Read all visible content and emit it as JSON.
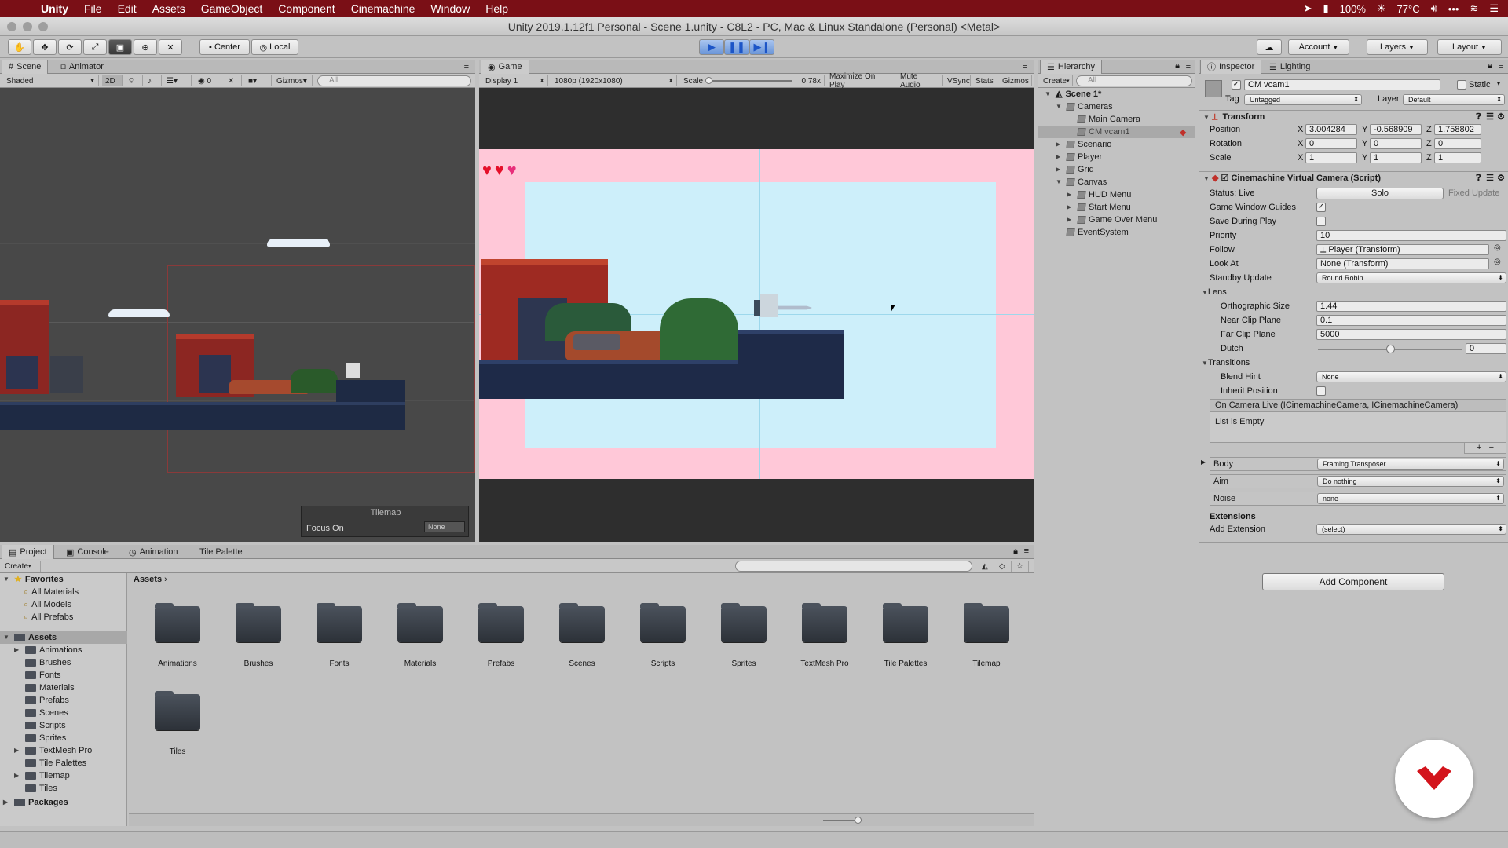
{
  "menubar": {
    "app": "Unity",
    "items": [
      "File",
      "Edit",
      "Assets",
      "GameObject",
      "Component",
      "Cinemachine",
      "Window",
      "Help"
    ],
    "battery": "100%",
    "temp": "77°C"
  },
  "window": {
    "title": "Unity 2019.1.12f1 Personal - Scene 1.unity - C8L2 - PC, Mac & Linux Standalone (Personal) <Metal>"
  },
  "toolbar": {
    "center": "Center",
    "local": "Local",
    "account": "Account",
    "layers": "Layers",
    "layout": "Layout"
  },
  "scene": {
    "tabs": [
      "Scene",
      "Animator"
    ],
    "shading": "Shaded",
    "mode2d": "2D",
    "gizmos": "Gizmos",
    "search": "All",
    "effects": "0",
    "tilemap_title": "Tilemap",
    "focus_label": "Focus On",
    "focus_value": "None"
  },
  "game": {
    "tab": "Game",
    "display": "Display 1",
    "resolution": "1080p (1920x1080)",
    "scale_label": "Scale",
    "scale_value": "0.78x",
    "buttons": [
      "Maximize On Play",
      "Mute Audio",
      "VSync",
      "Stats",
      "Gizmos"
    ]
  },
  "hierarchy": {
    "tab": "Hierarchy",
    "create": "Create",
    "search": "All",
    "scene": "Scene 1*",
    "items": [
      {
        "label": "Cameras",
        "depth": 1,
        "arrow": "▼"
      },
      {
        "label": "Main Camera",
        "depth": 2,
        "arrow": ""
      },
      {
        "label": "CM vcam1",
        "depth": 2,
        "arrow": "",
        "selected": true
      },
      {
        "label": "Scenario",
        "depth": 1,
        "arrow": "▶"
      },
      {
        "label": "Player",
        "depth": 1,
        "arrow": "▶"
      },
      {
        "label": "Grid",
        "depth": 1,
        "arrow": "▶"
      },
      {
        "label": "Canvas",
        "depth": 1,
        "arrow": "▼"
      },
      {
        "label": "HUD Menu",
        "depth": 2,
        "arrow": "▶"
      },
      {
        "label": "Start Menu",
        "depth": 2,
        "arrow": "▶"
      },
      {
        "label": "Game Over Menu",
        "depth": 2,
        "arrow": "▶"
      },
      {
        "label": "EventSystem",
        "depth": 1,
        "arrow": ""
      }
    ]
  },
  "inspector": {
    "tabs": [
      "Inspector",
      "Lighting"
    ],
    "object_name": "CM vcam1",
    "static": "Static",
    "tag_label": "Tag",
    "tag": "Untagged",
    "layer_label": "Layer",
    "layer": "Default",
    "transform": {
      "title": "Transform",
      "rows": [
        {
          "label": "Position",
          "x": "3.004284",
          "y": "-0.568909",
          "z": "1.758802"
        },
        {
          "label": "Rotation",
          "x": "0",
          "y": "0",
          "z": "0"
        },
        {
          "label": "Scale",
          "x": "1",
          "y": "1",
          "z": "1"
        }
      ]
    },
    "vcam": {
      "title": "Cinemachine Virtual Camera (Script)",
      "status": "Status: Live",
      "solo": "Solo",
      "fixed_update": "Fixed Update",
      "game_window_guides": "Game Window Guides",
      "save_during_play": "Save During Play",
      "priority_label": "Priority",
      "priority": "10",
      "follow_label": "Follow",
      "follow": "Player (Transform)",
      "lookat_label": "Look At",
      "lookat": "None (Transform)",
      "standby_label": "Standby Update",
      "standby": "Round Robin",
      "lens": "Lens",
      "ortho_label": "Orthographic Size",
      "ortho": "1.44",
      "near_label": "Near Clip Plane",
      "near": "0.1",
      "far_label": "Far Clip Plane",
      "far": "5000",
      "dutch_label": "Dutch",
      "dutch": "0",
      "dutch_fraction": 0.5,
      "transitions": "Transitions",
      "blend_label": "Blend Hint",
      "blend": "None",
      "inherit_label": "Inherit Position",
      "event": "On Camera Live (ICinemachineCamera, ICinemachineCamera)",
      "list_empty": "List is Empty",
      "body_label": "Body",
      "body": "Framing Transposer",
      "aim_label": "Aim",
      "aim": "Do nothing",
      "noise_label": "Noise",
      "noise": "none",
      "extensions": "Extensions",
      "add_ext_label": "Add Extension",
      "add_ext": "(select)"
    },
    "add_component": "Add Component"
  },
  "project": {
    "tabs": [
      "Project",
      "Console",
      "Animation",
      "Tile Palette"
    ],
    "create": "Create",
    "breadcrumb": "Assets",
    "favorites": {
      "label": "Favorites",
      "items": [
        "All Materials",
        "All Models",
        "All Prefabs"
      ]
    },
    "tree_root": "Assets",
    "tree": [
      {
        "label": "Animations",
        "arrow": "▶"
      },
      {
        "label": "Brushes",
        "arrow": ""
      },
      {
        "label": "Fonts",
        "arrow": ""
      },
      {
        "label": "Materials",
        "arrow": ""
      },
      {
        "label": "Prefabs",
        "arrow": ""
      },
      {
        "label": "Scenes",
        "arrow": ""
      },
      {
        "label": "Scripts",
        "arrow": ""
      },
      {
        "label": "Sprites",
        "arrow": ""
      },
      {
        "label": "TextMesh Pro",
        "arrow": "▶"
      },
      {
        "label": "Tile Palettes",
        "arrow": ""
      },
      {
        "label": "Tilemap",
        "arrow": "▶"
      },
      {
        "label": "Tiles",
        "arrow": ""
      }
    ],
    "packages": "Packages",
    "folders": [
      "Animations",
      "Brushes",
      "Fonts",
      "Materials",
      "Prefabs",
      "Scenes",
      "Scripts",
      "Sprites",
      "TextMesh Pro",
      "Tile Palettes",
      "Tilemap",
      "Tiles"
    ]
  },
  "colors": {
    "menubar": "#7a0f16",
    "accent": "#3d7bd9",
    "selected": "#8fa8cf"
  }
}
